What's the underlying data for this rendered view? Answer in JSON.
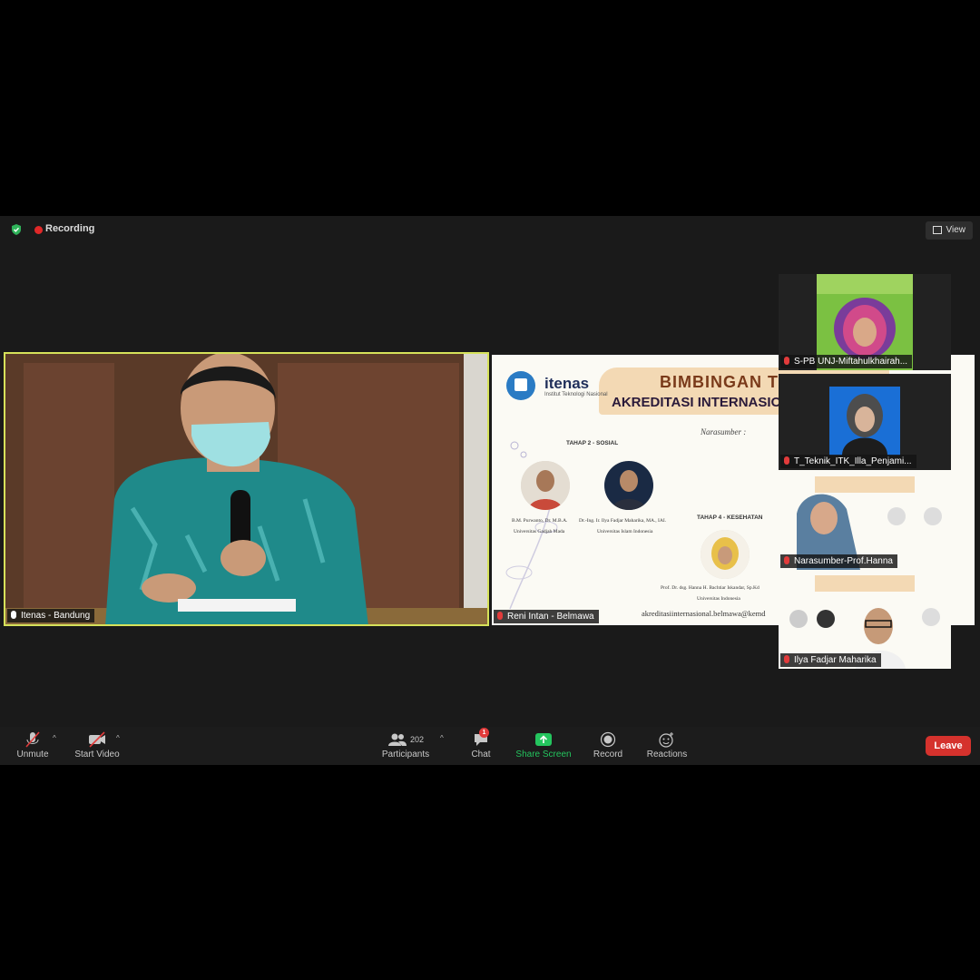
{
  "status": {
    "recording_label": "Recording",
    "view_label": "View"
  },
  "main_video": {
    "participant_name": "Itenas - Bandung"
  },
  "shared_screen": {
    "participant_name": "Reni Intan - Belmawa",
    "brand": "itenas",
    "brand_subtitle": "Institut Teknologi Nasional",
    "title_line1": "BIMBINGAN TE",
    "title_line2": "AKREDITASI INTERNASIONAL",
    "narasumber_label": "Narasumber :",
    "sections": [
      {
        "label": "TAHAP 2 - SOSIAL"
      },
      {
        "label": "TAHAP 4 - KESEHATAN"
      }
    ],
    "speakers": [
      {
        "name": "B.M. Purwanto, Dr. M.B.A.",
        "affiliation": "Universitas Gadjah Mada"
      },
      {
        "name": "Dr.-Ing. Ir. Ilya Fadjar Maharika, MA., IAI.",
        "affiliation": "Universitas Islam Indonesia"
      },
      {
        "name": "Prof. Dr. dsg. Hanna H. Bachtiar Iskandar, Sp.Kd",
        "affiliation": "Universitas Indonesia"
      }
    ],
    "email": "akreditasiinternasional.belmawa@kemd"
  },
  "side_participants": [
    {
      "name": "S-PB UNJ-Miftahulkhairah..."
    },
    {
      "name": "T_Teknik_ITK_Illa_Penjami..."
    },
    {
      "name": "Narasumber-Prof.Hanna"
    },
    {
      "name": "Ilya Fadjar Maharika"
    }
  ],
  "toolbar": {
    "unmute_label": "Unmute",
    "start_video_label": "Start Video",
    "participants_label": "Participants",
    "participants_count": "202",
    "chat_label": "Chat",
    "chat_badge": "1",
    "share_screen_label": "Share Screen",
    "record_label": "Record",
    "reactions_label": "Reactions",
    "leave_label": "Leave"
  },
  "colors": {
    "active_speaker_border": "#d6e25a",
    "leave": "#d5322d",
    "share_screen": "#24c55e",
    "recording_dot": "#e02828"
  }
}
